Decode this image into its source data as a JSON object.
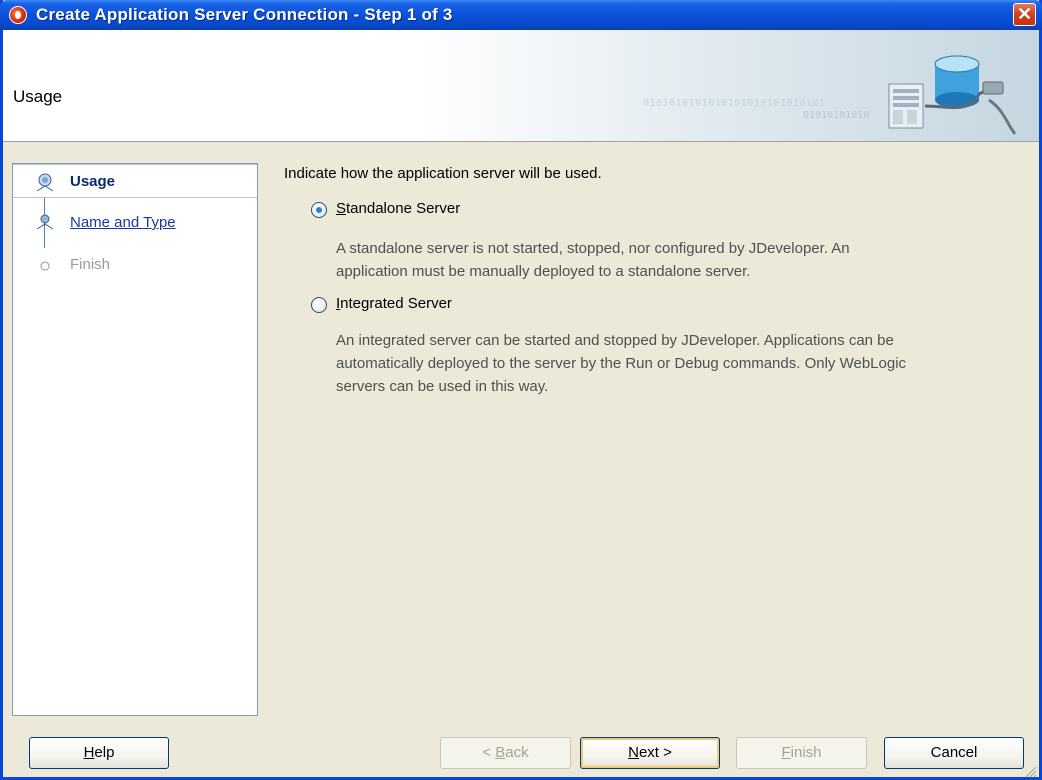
{
  "window": {
    "title": "Create Application Server Connection - Step 1 of 3",
    "close_glyph": "✕"
  },
  "banner": {
    "title": "Usage",
    "binary_text": "0101010101010101010101010101",
    "binary_text2": "01010101010"
  },
  "steps": [
    {
      "label": "Usage",
      "state": "active",
      "icon": "step-current-icon"
    },
    {
      "label": "Name and Type",
      "state": "link",
      "icon": "step-pending-icon"
    },
    {
      "label": "Finish",
      "state": "disabled",
      "icon": "step-empty-icon"
    }
  ],
  "content": {
    "prompt": "Indicate how  the application server will be used.",
    "options": [
      {
        "label": "Standalone Server",
        "mnemonic": "S",
        "selected": true,
        "description_lines": [
          "A standalone server is not started, stopped, nor configured by JDeveloper. An",
          "application must be manually deployed to a standalone server."
        ]
      },
      {
        "label": "Integrated Server",
        "mnemonic": "I",
        "selected": false,
        "description_lines": [
          "An integrated server can be started and stopped by JDeveloper. Applications can be",
          "automatically deployed to the server by the Run or Debug commands. Only WebLogic",
          "servers can be used in this way."
        ]
      }
    ]
  },
  "buttons": {
    "help": "Help",
    "back": "< Back",
    "next": "Next >",
    "finish": "Finish",
    "cancel": "Cancel"
  },
  "colors": {
    "titlebar": "#0a52d9",
    "link": "#1a3a9a",
    "active_step": "#0a2a70",
    "radio_dot": "#2a7fd4"
  }
}
